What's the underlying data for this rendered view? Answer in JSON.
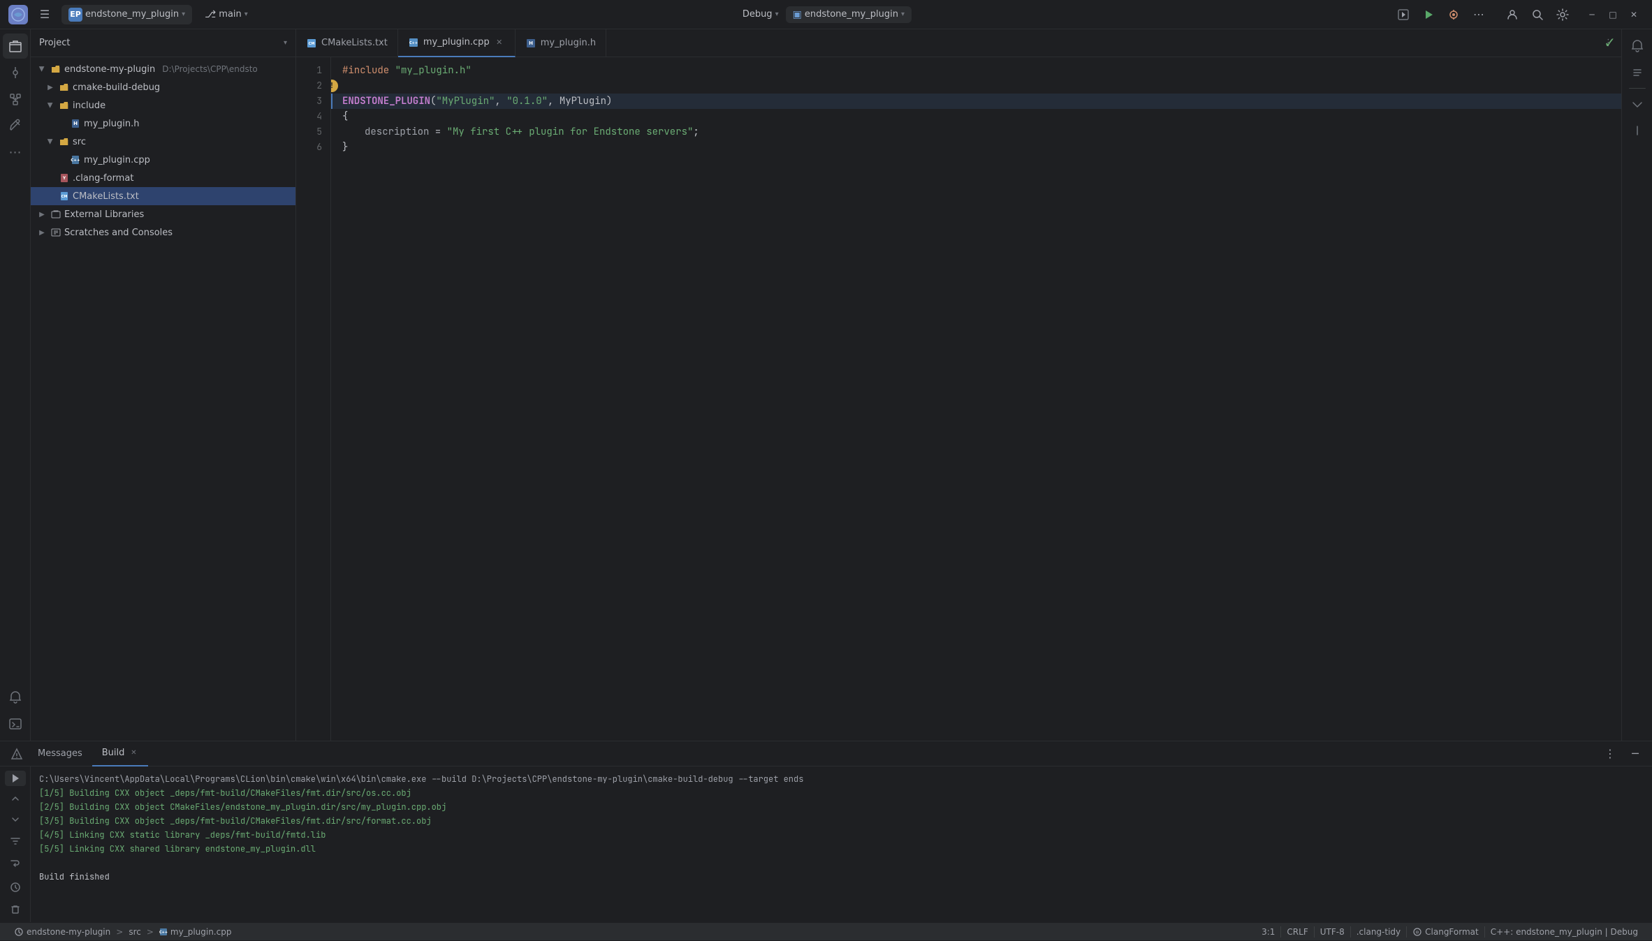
{
  "titlebar": {
    "logo": "EP",
    "project_name": "endstone_my_plugin",
    "branch": "main",
    "debug_config": "Debug",
    "run_target": "endstone_my_plugin",
    "menu_label": "☰"
  },
  "project_panel": {
    "title": "Project",
    "tree": [
      {
        "id": "root",
        "label": "endstone-my-plugin",
        "path": "D:\\Projects\\CPP\\endsto",
        "level": 0,
        "type": "folder",
        "open": true
      },
      {
        "id": "cmake-build",
        "label": "cmake-build-debug",
        "level": 1,
        "type": "folder",
        "open": false
      },
      {
        "id": "include",
        "label": "include",
        "level": 1,
        "type": "folder",
        "open": true
      },
      {
        "id": "my_plugin_h",
        "label": "my_plugin.h",
        "level": 2,
        "type": "header-file"
      },
      {
        "id": "src",
        "label": "src",
        "level": 1,
        "type": "folder",
        "open": true
      },
      {
        "id": "my_plugin_cpp",
        "label": "my_plugin.cpp",
        "level": 2,
        "type": "cpp-file"
      },
      {
        "id": "clang_format",
        "label": ".clang-format",
        "level": 1,
        "type": "yaml-file"
      },
      {
        "id": "cmake_lists",
        "label": "CMakeLists.txt",
        "level": 1,
        "type": "cmake-file",
        "selected": true
      },
      {
        "id": "ext_libs",
        "label": "External Libraries",
        "level": 0,
        "type": "folder",
        "open": false
      },
      {
        "id": "scratches",
        "label": "Scratches and Consoles",
        "level": 0,
        "type": "folder",
        "open": false
      }
    ]
  },
  "tabs": [
    {
      "id": "cmake",
      "label": "CMakeLists.txt",
      "icon": "cmake",
      "active": false,
      "closeable": false
    },
    {
      "id": "my_plugin_cpp",
      "label": "my_plugin.cpp",
      "icon": "cpp",
      "active": true,
      "closeable": true
    },
    {
      "id": "my_plugin_h",
      "label": "my_plugin.h",
      "icon": "header",
      "active": false,
      "closeable": false
    }
  ],
  "code": {
    "lines": [
      {
        "num": 1,
        "content": "#include \"my_plugin.h\"",
        "type": "include"
      },
      {
        "num": 2,
        "content": "",
        "type": "empty"
      },
      {
        "num": 3,
        "content": "ENDSTONE_PLUGIN(\"MyPlugin\", \"0.1.0\", MyPlugin)",
        "type": "macro",
        "highlighted": true
      },
      {
        "num": 4,
        "content": "{",
        "type": "brace"
      },
      {
        "num": 5,
        "content": "    description = \"My first C++ plugin for Endstone servers\";",
        "type": "field"
      },
      {
        "num": 6,
        "content": "}",
        "type": "brace"
      }
    ],
    "has_tip_line": 2
  },
  "bottom_panel": {
    "tabs": [
      {
        "id": "messages",
        "label": "Messages",
        "active": false
      },
      {
        "id": "build",
        "label": "Build",
        "active": true,
        "closeable": true
      }
    ],
    "build_output": [
      "C:\\Users\\Vincent\\AppData\\Local\\Programs\\CLion\\bin\\cmake\\win\\x64\\bin\\cmake.exe --build D:\\Projects\\CPP\\endstone-my-plugin\\cmake-build-debug --target ends",
      "[1/5] Building CXX object _deps/fmt-build/CMakeFiles/fmt.dir/src/os.cc.obj",
      "[2/5] Building CXX object CMakeFiles/endstone_my_plugin.dir/src/my_plugin.cpp.obj",
      "[3/5] Building CXX object _deps/fmt-build/CMakeFiles/fmt.dir/src/format.cc.obj",
      "[4/5] Linking CXX static library _deps/fmt-build/fmtd.lib",
      "[5/5] Linking CXX shared library endstone_my_plugin.dll",
      "",
      "Build finished"
    ]
  },
  "status_bar": {
    "project": "endstone-my-plugin",
    "path_sep1": ">",
    "src": "src",
    "path_sep2": ">",
    "file": "my_plugin.cpp",
    "position": "3:1",
    "line_ending": "CRLF",
    "encoding": "UTF-8",
    "clang_tidy": ".clang-tidy",
    "clang_format": "ClangFormat",
    "config": "C++: endstone_my_plugin | Debug"
  }
}
